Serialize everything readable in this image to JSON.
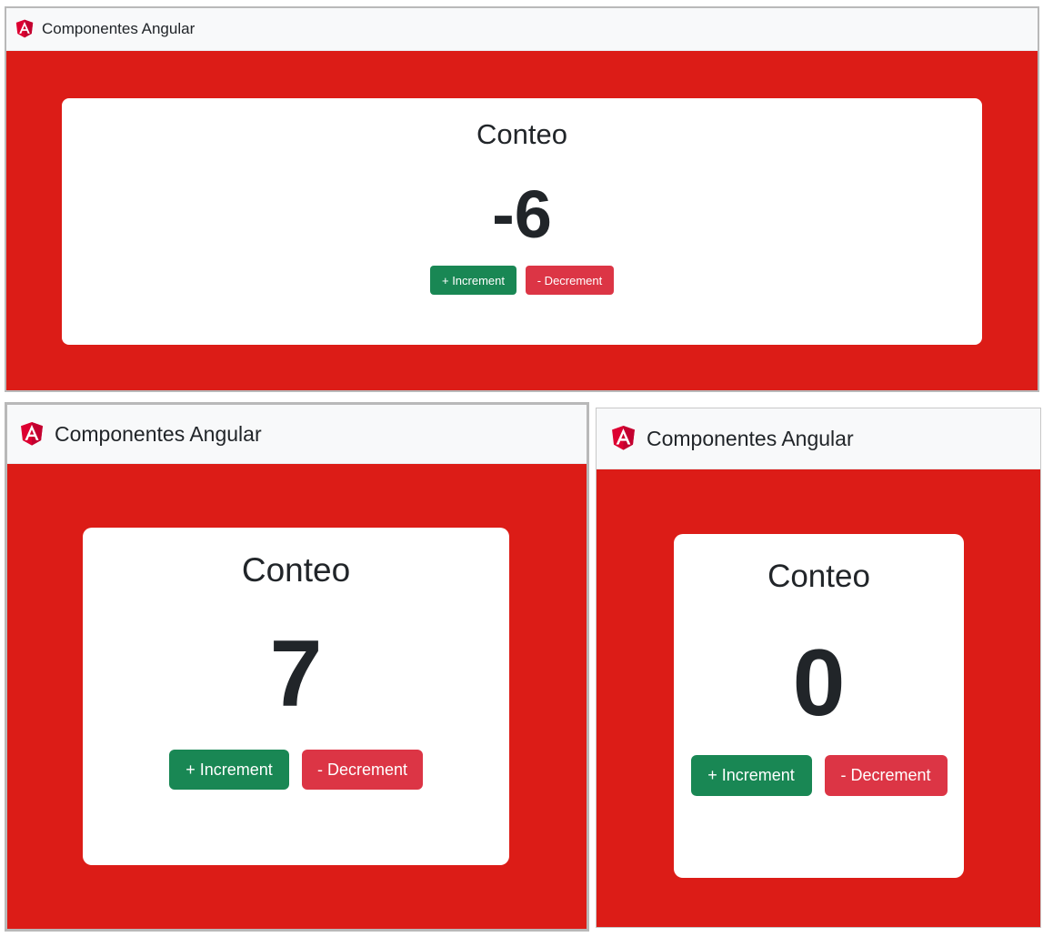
{
  "colors": {
    "page_background": "#dc1c17",
    "navbar_background": "#f8f9fa",
    "increment_button": "#198754",
    "decrement_button": "#dc3545",
    "angular_logo": "#dd0031"
  },
  "windows": [
    {
      "navbar": {
        "logo_icon": "angular-logo-icon",
        "title": "Componentes Angular"
      },
      "card": {
        "title": "Conteo",
        "count": "-6",
        "increment_label": "+ Increment",
        "decrement_label": "- Decrement"
      }
    },
    {
      "navbar": {
        "logo_icon": "angular-logo-icon",
        "title": "Componentes Angular"
      },
      "card": {
        "title": "Conteo",
        "count": "7",
        "increment_label": "+ Increment",
        "decrement_label": "- Decrement"
      }
    },
    {
      "navbar": {
        "logo_icon": "angular-logo-icon",
        "title": "Componentes Angular"
      },
      "card": {
        "title": "Conteo",
        "count": "0",
        "increment_label": "+ Increment",
        "decrement_label": "- Decrement"
      }
    }
  ]
}
